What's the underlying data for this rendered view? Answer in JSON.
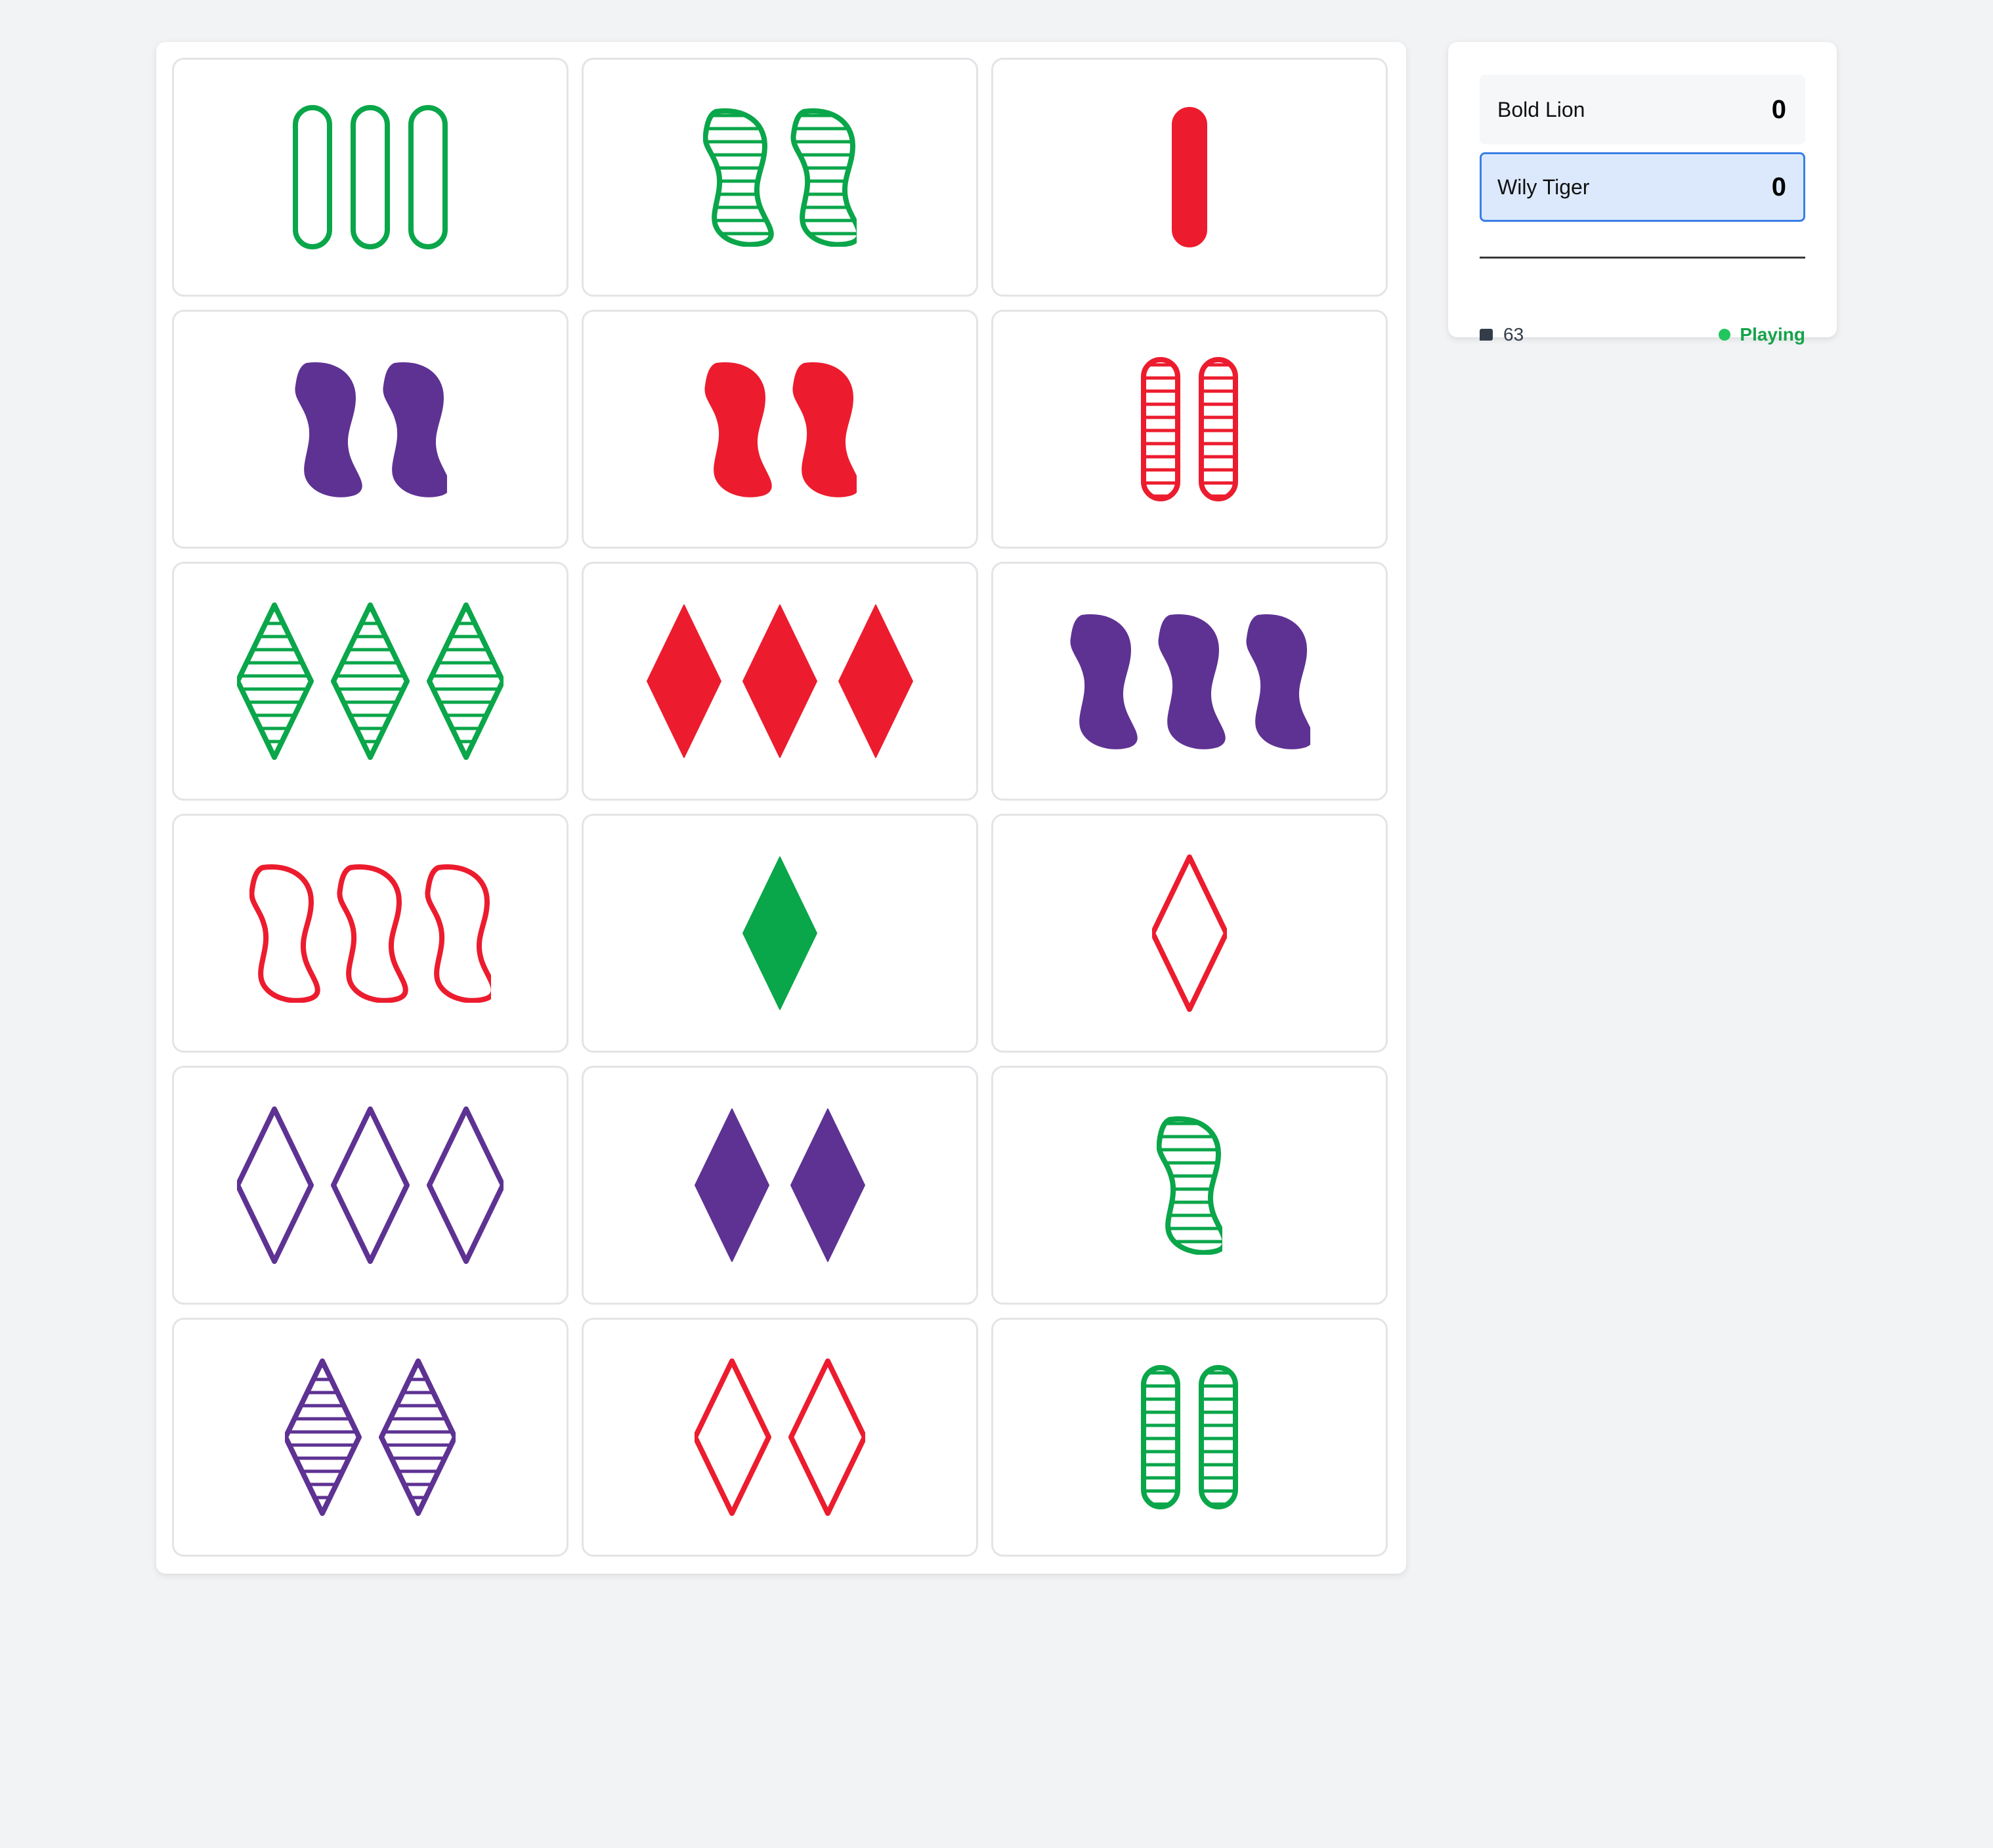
{
  "players": [
    {
      "name": "Bold Lion",
      "score": "0",
      "active": false
    },
    {
      "name": "Wily Tiger",
      "score": "0",
      "active": true
    }
  ],
  "footer": {
    "deck_icon": "card-stack-icon",
    "deck_count": "63",
    "status": "Playing"
  },
  "colors": {
    "red": "#ec1c2e",
    "green": "#0aa64a",
    "purple": "#5e3293"
  },
  "cards": [
    {
      "count": 3,
      "shape": "oval",
      "color": "green",
      "fill": "open"
    },
    {
      "count": 2,
      "shape": "squiggle",
      "color": "green",
      "fill": "striped"
    },
    {
      "count": 1,
      "shape": "oval",
      "color": "red",
      "fill": "solid"
    },
    {
      "count": 2,
      "shape": "squiggle",
      "color": "purple",
      "fill": "solid"
    },
    {
      "count": 2,
      "shape": "squiggle",
      "color": "red",
      "fill": "solid"
    },
    {
      "count": 2,
      "shape": "oval",
      "color": "red",
      "fill": "striped"
    },
    {
      "count": 3,
      "shape": "diamond",
      "color": "green",
      "fill": "striped"
    },
    {
      "count": 3,
      "shape": "diamond",
      "color": "red",
      "fill": "solid"
    },
    {
      "count": 3,
      "shape": "squiggle",
      "color": "purple",
      "fill": "solid"
    },
    {
      "count": 3,
      "shape": "squiggle",
      "color": "red",
      "fill": "open"
    },
    {
      "count": 1,
      "shape": "diamond",
      "color": "green",
      "fill": "solid"
    },
    {
      "count": 1,
      "shape": "diamond",
      "color": "red",
      "fill": "open"
    },
    {
      "count": 3,
      "shape": "diamond",
      "color": "purple",
      "fill": "open"
    },
    {
      "count": 2,
      "shape": "diamond",
      "color": "purple",
      "fill": "solid"
    },
    {
      "count": 1,
      "shape": "squiggle",
      "color": "green",
      "fill": "striped"
    },
    {
      "count": 2,
      "shape": "diamond",
      "color": "purple",
      "fill": "striped"
    },
    {
      "count": 2,
      "shape": "diamond",
      "color": "red",
      "fill": "open"
    },
    {
      "count": 2,
      "shape": "oval",
      "color": "green",
      "fill": "striped"
    }
  ]
}
